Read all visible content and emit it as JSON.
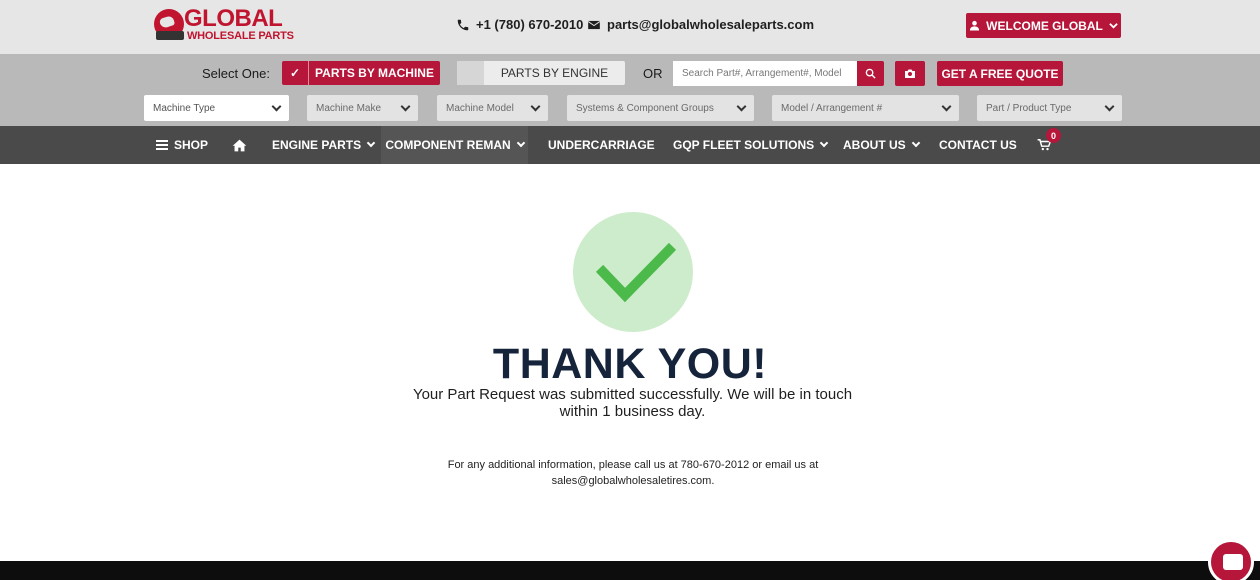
{
  "header": {
    "logo_text": "GLOBAL",
    "logo_sub": "WHOLESALE PARTS",
    "phone": "+1 (780) 670-2010",
    "email": "parts@globalwholesaleparts.com",
    "welcome_label": "WELCOME GLOBAL",
    "icons": [
      "phone-icon",
      "mail-icon",
      "user-icon",
      "chevron-down-icon"
    ]
  },
  "filters": {
    "select_label": "Select One:",
    "machine_label": "PARTS BY MACHINE",
    "engine_label": "PARTS BY ENGINE",
    "or_label": "OR",
    "search_placeholder": "Search Part#, Arrangement#, Model",
    "quote_label": "GET A FREE QUOTE",
    "dropdowns": [
      "Machine Type",
      "Machine Make",
      "Machine Model",
      "Systems & Component Groups",
      "Model / Arrangement #",
      "Part / Product Type"
    ]
  },
  "nav": {
    "shop": "SHOP",
    "engine_parts": "ENGINE PARTS",
    "component_reman": "COMPONENT REMAN",
    "undercarriage": "UNDERCARRIAGE",
    "gqp": "GQP FLEET SOLUTIONS",
    "about": "ABOUT US",
    "contact": "CONTACT US",
    "cart_count": "0"
  },
  "main": {
    "title": "THANK YOU!",
    "message": "Your Part Request was submitted successfully. We will be in touch within 1 business day.",
    "info": "For any additional information, please call us at 780-670-2012 or email us at sales@globalwholesaletires.com."
  },
  "colors": {
    "accent": "#b5163a",
    "nav_bg": "#4a4a4a",
    "success_circle": "#cdeccb",
    "success_check": "#4cba4a"
  }
}
